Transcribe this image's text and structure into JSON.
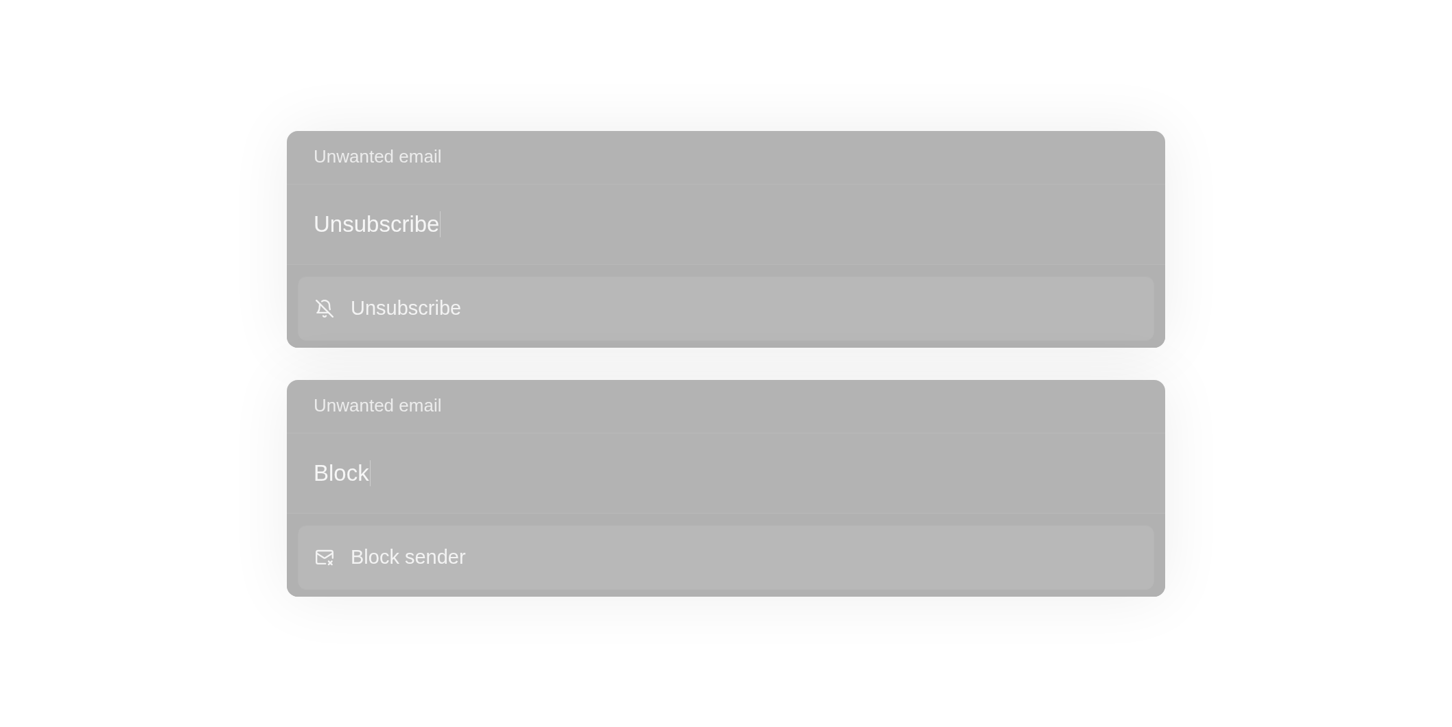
{
  "palettes": [
    {
      "group": "Unwanted email",
      "input": {
        "value": "Unsubscribe",
        "focused": true
      },
      "options": [
        {
          "kind": "unsubscribe",
          "label": "Unsubscribe",
          "selected": true
        }
      ]
    },
    {
      "group": "Unwanted email",
      "input": {
        "value": "Block",
        "focused": true
      },
      "options": [
        {
          "kind": "block",
          "label": "Block sender",
          "selected": true
        }
      ]
    }
  ]
}
